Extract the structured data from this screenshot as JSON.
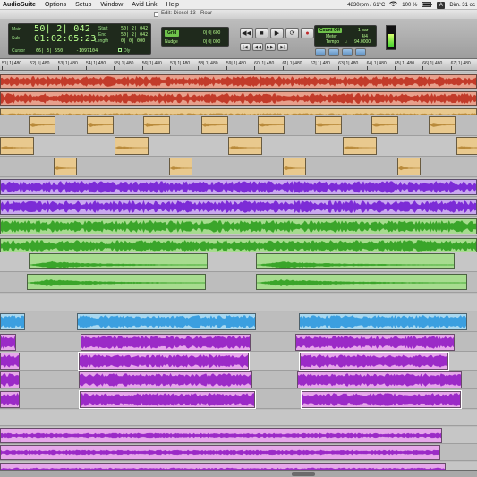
{
  "menubar": {
    "app_name": "AudioSuite",
    "items": [
      "Options",
      "Setup",
      "Window",
      "Avid Link",
      "Help"
    ],
    "status": "4830rpm / 61°C",
    "battery": "100 %",
    "user_badge": "A",
    "datetime": "Dim. 31 oc"
  },
  "window": {
    "title": "Edit: Diesel 13 - Roar"
  },
  "counter": {
    "main_label": "Main",
    "sub_label": "Sub",
    "cursor_label": "Cursor",
    "main_value": "50| 2| 042",
    "sub_value": "01:02:05:23",
    "start_label": "Start",
    "end_label": "End",
    "length_label": "Length",
    "start_value": "50| 2| 042",
    "end_value": "50| 2| 042",
    "length_value": "0| 0| 000",
    "cursor_value": "66| 3| 550",
    "cursor_db": "-1097104",
    "dly_label": "Dly"
  },
  "grid": {
    "grid_label": "Grid",
    "grid_value": "0| 0| 600",
    "nudge_label": "Nudge",
    "nudge_value": "0| 0| 000"
  },
  "transport": {
    "buttons": [
      "◀◀",
      "■",
      "▶",
      "⟳",
      "●"
    ],
    "row2": [
      "|◀",
      "◀◀",
      "▶▶",
      "▶|"
    ]
  },
  "tempo": {
    "count_off_label": "Count Off",
    "count_off_value": "1 bar",
    "meter_label": "Meter",
    "meter_value": "4/4",
    "tempo_label": "Tempo",
    "tempo_value": "94.0000",
    "meter_level": 0.62
  },
  "ruler": {
    "ticks": [
      "51| 1| 480",
      "52| 1| 480",
      "53| 1| 480",
      "54| 1| 480",
      "55| 1| 480",
      "56| 1| 480",
      "57| 1| 480",
      "58| 1| 480",
      "59| 1| 480",
      "60| 1| 480",
      "61| 1| 480",
      "62| 1| 480",
      "63| 1| 480",
      "64| 1| 480",
      "65| 1| 480",
      "66| 1| 480",
      "67| 1| 480"
    ]
  },
  "colors": {
    "red_clip": "#e8a08c",
    "tan_clip": "#e9c98e",
    "purple_clip": "#c9a8ef",
    "green_clip": "#a7dc8f",
    "blue_clip": "#a9d8f0",
    "magenta_clip": "#e6a7ea",
    "selected_outline": "#ffffff",
    "counter_text": "#b8ff8e"
  }
}
